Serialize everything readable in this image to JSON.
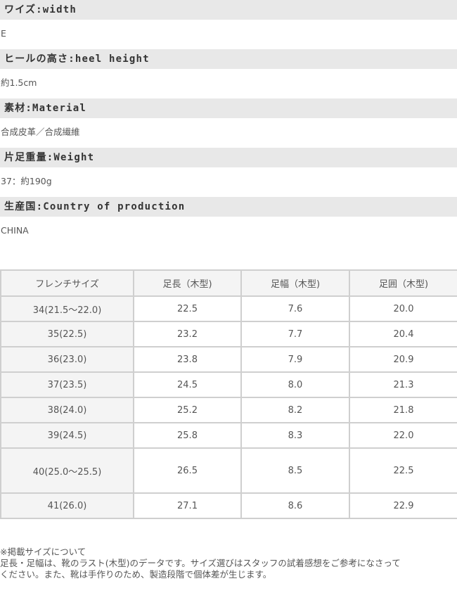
{
  "specs": [
    {
      "label": "ワイズ:width",
      "value": "E"
    },
    {
      "label": "ヒールの高さ:heel height",
      "value": "約1.5cm"
    },
    {
      "label": "素材:Material",
      "value": "合成皮革／合成繊維"
    },
    {
      "label": "片足重量:Weight",
      "value": "37：約190g"
    },
    {
      "label": "生産国:Country of production",
      "value": "CHINA"
    }
  ],
  "size_table": {
    "headers": [
      "フレンチサイズ",
      "足長（木型)",
      "足幅（木型)",
      "足囲（木型)"
    ],
    "rows": [
      [
        "34(21.5～22.0)",
        "22.5",
        "7.6",
        "20.0"
      ],
      [
        "35(22.5)",
        "23.2",
        "7.7",
        "20.4"
      ],
      [
        "36(23.0)",
        "23.8",
        "7.9",
        "20.9"
      ],
      [
        "37(23.5)",
        "24.5",
        "8.0",
        "21.3"
      ],
      [
        "38(24.0)",
        "25.2",
        "8.2",
        "21.8"
      ],
      [
        "39(24.5)",
        "25.8",
        "8.3",
        "22.0"
      ],
      [
        "40(25.0～25.5)",
        "26.5",
        "8.5",
        "22.5"
      ],
      [
        "41(26.0)",
        "27.1",
        "8.6",
        "22.9"
      ]
    ]
  },
  "notes": {
    "title": "※掲載サイズについて",
    "line1": "足長・足幅は、靴のラスト(木型)のデータです。サイズ選びはスタッフの試着感想をご参考になさって",
    "line2": "ください。また、靴は手作りのため、製造段階で個体差が生じます。"
  }
}
